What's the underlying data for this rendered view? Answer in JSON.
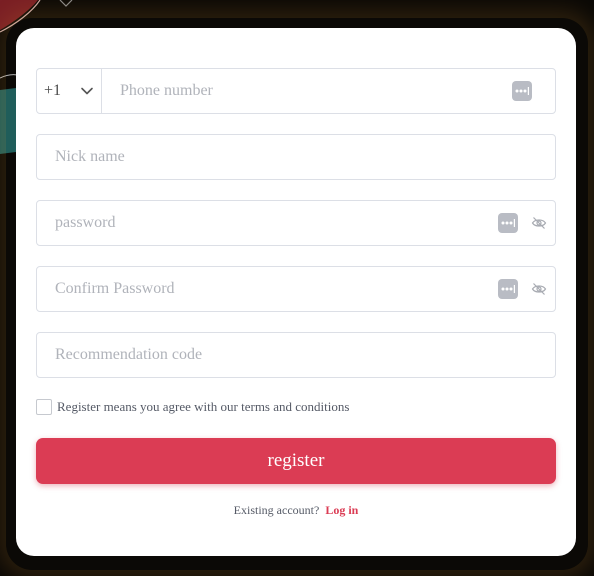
{
  "form": {
    "country_code": "+1",
    "phone_placeholder": "Phone number",
    "nickname_placeholder": "Nick name",
    "password_placeholder": "password",
    "confirm_password_placeholder": "Confirm Password",
    "recommendation_placeholder": "Recommendation code",
    "agree_text": "Register means you agree with our terms and conditions",
    "agree_checked": false,
    "register_label": "register",
    "existing_account_text": "Existing account?",
    "login_label": "Log in"
  },
  "icons": {
    "country_dropdown": "chevron-down-icon",
    "autofill": "password-manager-dots-icon",
    "visibility": "eye-off-icon"
  },
  "colors": {
    "accent": "#db3c54",
    "card_background": "#ffffff",
    "page_background": "#0b0906",
    "input_border": "#dcdfe6",
    "placeholder": "#b0b3ba"
  }
}
